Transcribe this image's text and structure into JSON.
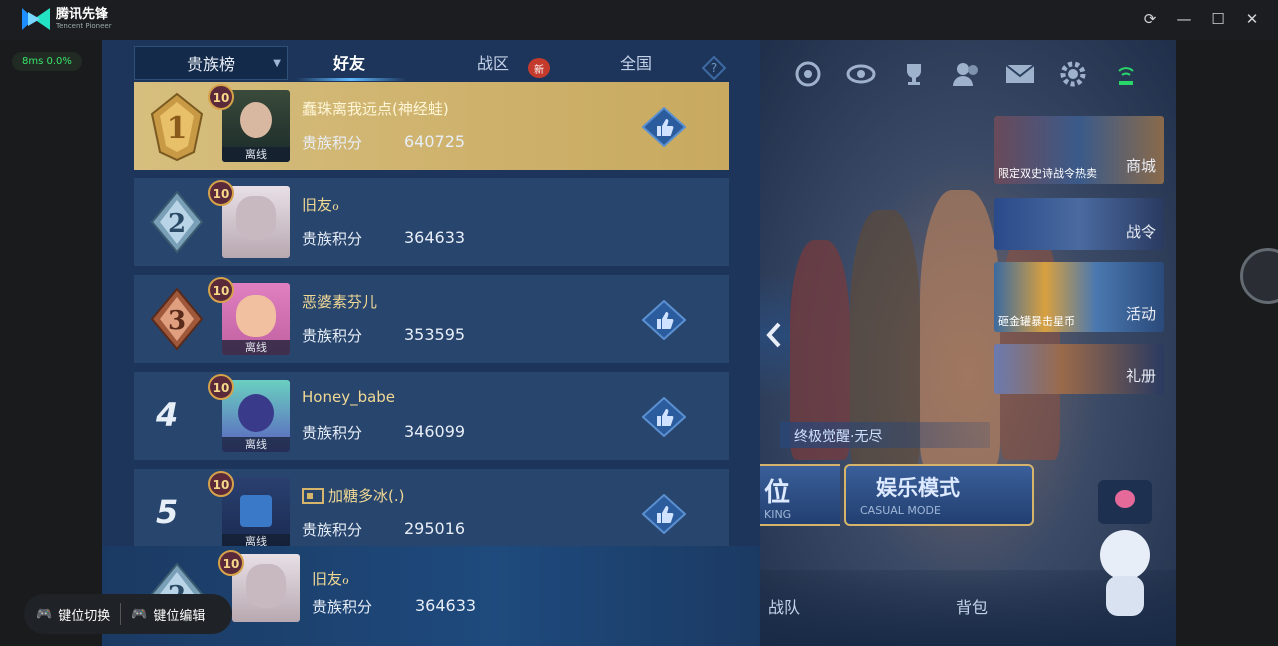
{
  "app": {
    "name": "腾讯先锋",
    "subtitle": "Tencent Pioneer"
  },
  "perf": {
    "text": "8ms  0.0%"
  },
  "tabs": {
    "dropdown_label": "贵族榜",
    "items": [
      {
        "label": "好友",
        "active": true
      },
      {
        "label": "战区",
        "active": false,
        "badge": "新"
      },
      {
        "label": "全国",
        "active": false
      }
    ]
  },
  "rows": [
    {
      "rank": "1",
      "level": "10",
      "name": "蠢珠离我远点(神经蛙)",
      "label": "贵族积分",
      "score": "640725",
      "status": "离线",
      "liked": true
    },
    {
      "rank": "2",
      "level": "10",
      "name": "旧友ℴ",
      "label": "贵族积分",
      "score": "364633",
      "status": "",
      "liked": false
    },
    {
      "rank": "3",
      "level": "10",
      "name": "恶婆素芬儿",
      "label": "贵族积分",
      "score": "353595",
      "status": "离线",
      "liked": true
    },
    {
      "rank": "4",
      "level": "10",
      "name": "Honey_babe",
      "label": "贵族积分",
      "score": "346099",
      "status": "离线",
      "liked": true
    },
    {
      "rank": "5",
      "level": "10",
      "name": "加糖多冰(.)",
      "label": "贵族积分",
      "score": "295016",
      "status": "离线",
      "liked": true
    }
  ],
  "self": {
    "rank": "2",
    "level": "10",
    "name": "旧友ℴ",
    "label": "贵族积分",
    "score": "364633"
  },
  "right_tiles": [
    {
      "caption": "限定双史诗战令热卖",
      "label": "商城"
    },
    {
      "caption": "",
      "label": "战令"
    },
    {
      "caption": "砸金罐暴击星币",
      "label": "活动"
    },
    {
      "caption": "",
      "label": "礼册"
    }
  ],
  "banner": {
    "text": "终极觉醒·无尽"
  },
  "mode": {
    "left_main": "位",
    "left_sub": "KING",
    "main": "娱乐模式",
    "sub": "CASUAL MODE"
  },
  "bottom": {
    "team": "战队",
    "bag": "背包"
  },
  "floatbar": {
    "switch": "键位切换",
    "edit": "键位编辑"
  },
  "colors": {
    "accent": "#5fb7ff",
    "gold": "#d6be7e",
    "name": "#f1d995",
    "panel": "#28456d"
  }
}
